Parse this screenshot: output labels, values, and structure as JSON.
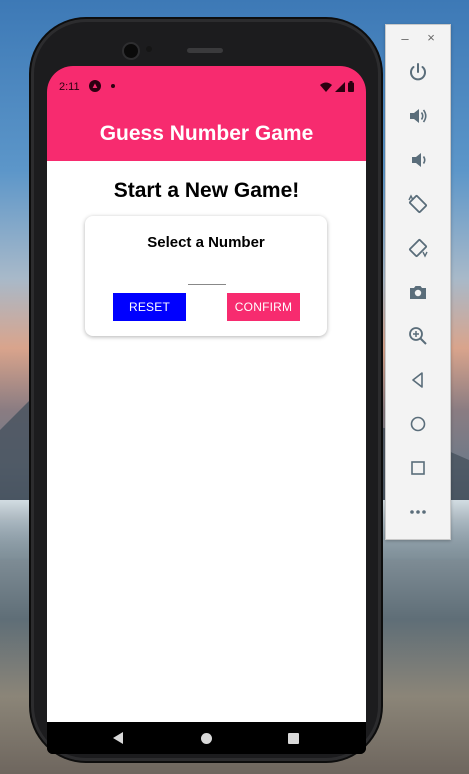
{
  "status_bar": {
    "time": "2:11"
  },
  "app_bar": {
    "title": "Guess Number Game"
  },
  "main": {
    "title": "Start a New Game!",
    "card": {
      "title": "Select a Number",
      "input_value": "",
      "reset_label": "RESET",
      "confirm_label": "CONFIRM"
    }
  },
  "colors": {
    "primary": "#f72b6f",
    "reset_button": "#0000ff",
    "background": "#ffffff"
  },
  "emulator_toolbar": {
    "window_controls": [
      "minimize-icon",
      "close-icon"
    ],
    "buttons": [
      "power-icon",
      "volume-up-icon",
      "volume-down-icon",
      "rotate-left-icon",
      "rotate-right-icon",
      "camera-icon",
      "zoom-icon",
      "back-icon",
      "home-icon",
      "overview-icon",
      "more-icon"
    ]
  }
}
